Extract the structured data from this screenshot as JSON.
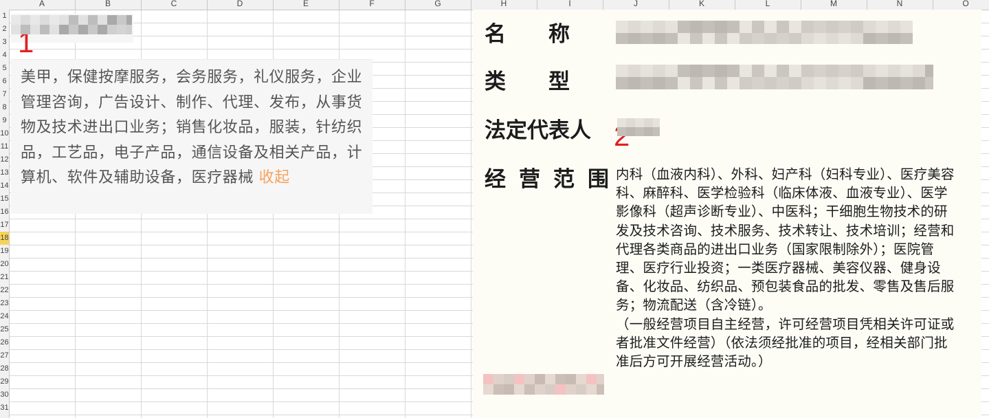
{
  "spreadsheet": {
    "columns": [
      "A",
      "B",
      "C",
      "D",
      "E",
      "F",
      "G",
      "H",
      "I",
      "J",
      "K",
      "L",
      "M",
      "N",
      "O"
    ],
    "rows": [
      "1",
      "2",
      "3",
      "4",
      "5",
      "6",
      "7",
      "8",
      "9",
      "10",
      "11",
      "12",
      "13",
      "14",
      "15",
      "16",
      "17",
      "18",
      "19",
      "20",
      "21",
      "22",
      "23",
      "24",
      "25",
      "26",
      "27",
      "28",
      "29",
      "30",
      "31"
    ],
    "selected_row": "18"
  },
  "panel1": {
    "marker": "1",
    "scope_text": "美甲，保健按摩服务，会务服务，礼仪服务，企业管理咨询，广告设计、制作、代理、发布，从事货物及技术进出口业务；销售化妆品，服装，针纺织品，工艺品，电子产品，通信设备及相关产品，计算机、软件及辅助设备，医疗器械",
    "collapse_label": "收起",
    "colors": {
      "collapse": "#f5a25d",
      "marker": "#e02020"
    }
  },
  "panel2": {
    "marker": "2",
    "label_name": "名　　称",
    "label_type": "类　　型",
    "label_rep": "法定代表人",
    "label_scope": "经营范围",
    "scope_text": "内科（血液内科）、外科、妇产科（妇科专业）、医疗美容科、麻醉科、医学检验科（临床体液、血液专业）、医学影像科（超声诊断专业）、中医科；干细胞生物技术的研发及技术咨询、技术服务、技术转让、技术培训；经营和代理各类商品的进出口业务（国家限制除外）；医院管理、医疗行业投资；一类医疗器械、美容仪器、健身设备、化妆品、纺织品、预包装食品的批发、零售及售后服务；物流配送（含冷链）。",
    "scope_note": "（一般经营项目自主经营，许可经营项目凭相关许可证或者批准文件经营）（依法须经批准的项目，经相关部门批准后方可开展经营活动。）"
  }
}
